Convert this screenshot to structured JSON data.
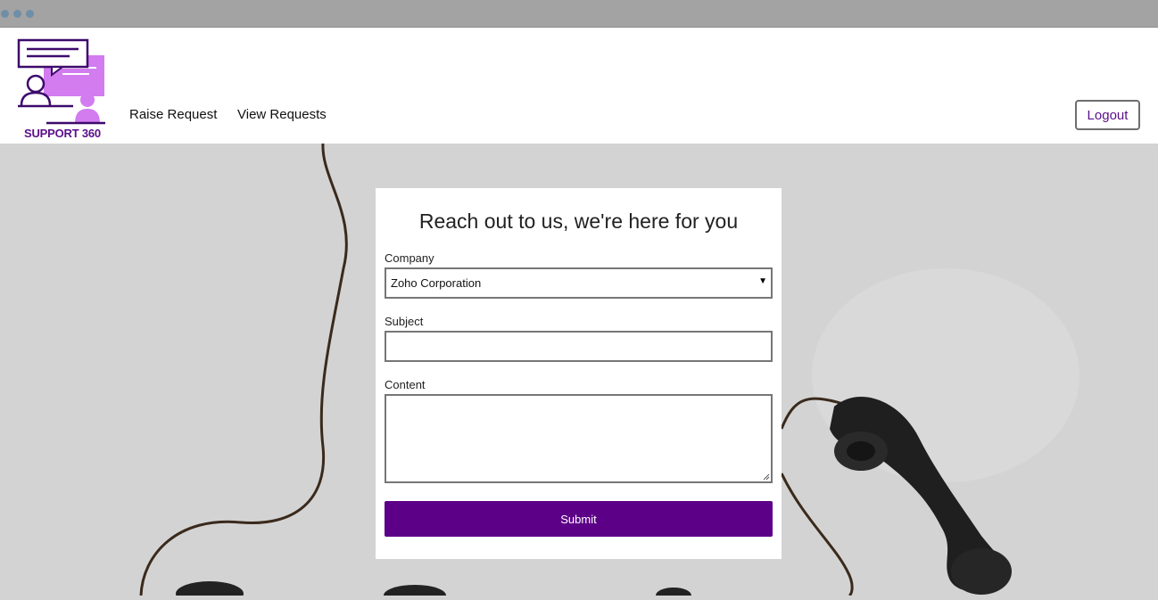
{
  "window": {
    "controls": [
      "close",
      "minimize",
      "maximize"
    ]
  },
  "header": {
    "logo_text": "SUPPORT 360",
    "nav": [
      {
        "label": "Raise Request"
      },
      {
        "label": "View Requests"
      }
    ],
    "logout_label": "Logout"
  },
  "form": {
    "title": "Reach out to us, we're here for you",
    "company": {
      "label": "Company",
      "selected": "Zoho Corporation"
    },
    "subject": {
      "label": "Subject",
      "value": ""
    },
    "content": {
      "label": "Content",
      "value": ""
    },
    "submit_label": "Submit"
  },
  "colors": {
    "brand": "#5c0087",
    "logo_light": "#d27cf0",
    "logo_dark": "#3d0a6b"
  },
  "icons": [
    "chat-support-logo-icon",
    "dropdown-arrow-icon",
    "resize-grip-icon"
  ]
}
